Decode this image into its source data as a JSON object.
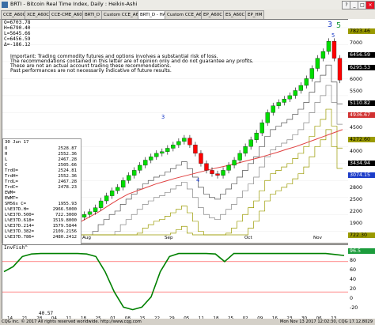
{
  "window": {
    "title": "BRTI - Bitcoin Real Time Index, Daily : Heikin-Ashi",
    "buttons": [
      "?",
      "_",
      "□",
      "×"
    ]
  },
  "tabs": [
    {
      "label": "CCE_A60C",
      "active": false
    },
    {
      "label": "XCE_A60C",
      "active": false
    },
    {
      "label": "CCE-CME_A60C",
      "active": false
    },
    {
      "label": "BRTI_D",
      "active": false
    },
    {
      "label": "Custom CCE_A60C",
      "active": false
    },
    {
      "label": "BRTI_D - HA",
      "active": true
    },
    {
      "label": "Custom CCE_A60C",
      "active": false
    },
    {
      "label": "EP_A60C",
      "active": false
    },
    {
      "label": "ES_A60C",
      "active": false
    },
    {
      "label": "EP_HM",
      "active": false
    }
  ],
  "ohlc": {
    "open": "O=6703.78",
    "high": "H=6790.40",
    "low": "L=5645.66",
    "close": "C=6456.59",
    "change": "Δ=-186.12"
  },
  "disclaimer": [
    "Important: Trading commodity futures and options involves a substantial risk of loss.",
    "The recommendations contained in this letter are of opinion only and do not guarantee any profits.",
    "These are not an actual account trading these recommendations.",
    "Past performances are not necessarily indicative of future results."
  ],
  "data_panel": {
    "date": "30 Jun 17",
    "rows": [
      {
        "label": "O",
        "value": "2528.87"
      },
      {
        "label": "H",
        "value": "2552.36"
      },
      {
        "label": "L",
        "value": "2467.28"
      },
      {
        "label": "C",
        "value": "2505.66"
      },
      {
        "label": "TrdO=",
        "value": "2524.81"
      },
      {
        "label": "TrdH=",
        "value": "2552.36"
      },
      {
        "label": "TrdL=",
        "value": "2467.28"
      },
      {
        "label": "TrdC=",
        "value": "2478.23"
      },
      {
        "label": "EWM=",
        "value": ""
      },
      {
        "label": "EWMT=",
        "value": ""
      },
      {
        "label": "SM56x C=",
        "value": "1955.93"
      },
      {
        "label": "L%E37D.H=",
        "value": "2966.5000"
      },
      {
        "label": "L%E37D.500=",
        "value": "722.3000"
      },
      {
        "label": "L%E37D.618=",
        "value": "1519.8000"
      },
      {
        "label": "L%E37D.214=",
        "value": "1579.5844"
      },
      {
        "label": "L%E37D.382=",
        "value": "2109.2156"
      },
      {
        "label": "L%E37D.786=",
        "value": "2480.2412"
      }
    ]
  },
  "price_axis": [
    {
      "label": "7823.46",
      "style": "olive"
    },
    {
      "label": "7000",
      "style": "plain"
    },
    {
      "label": "6456.59",
      "style": "black"
    },
    {
      "label": "6295.53",
      "style": "black"
    },
    {
      "label": "6000",
      "style": "plain"
    },
    {
      "label": "5500",
      "style": "plain"
    },
    {
      "label": "5110.82",
      "style": "black"
    },
    {
      "label": "4936.67",
      "style": "red"
    },
    {
      "label": "4500",
      "style": "plain"
    },
    {
      "label": "4272.60",
      "style": "olive"
    },
    {
      "label": "4000",
      "style": "plain"
    },
    {
      "label": "3434.94",
      "style": "black"
    },
    {
      "label": "3074.15",
      "style": "blue"
    },
    {
      "label": "2800",
      "style": "plain"
    },
    {
      "label": "2500",
      "style": "plain"
    },
    {
      "label": "2200",
      "style": "plain"
    },
    {
      "label": "1900",
      "style": "plain"
    },
    {
      "label": "722.30",
      "style": "olive"
    }
  ],
  "indicator": {
    "name": "InvFish^",
    "value": "40.57",
    "axis": [
      {
        "label": "96.5",
        "style": "green"
      },
      {
        "label": "80",
        "style": "plain"
      },
      {
        "label": "60",
        "style": "plain"
      },
      {
        "label": "40",
        "style": "plain"
      },
      {
        "label": "20",
        "style": "plain"
      },
      {
        "label": "0",
        "style": "plain"
      },
      {
        "label": "-20",
        "style": "plain"
      }
    ]
  },
  "wave_labels": [
    "3",
    "3",
    "4",
    "5",
    "5"
  ],
  "time_axis": [
    "Aug",
    "Sep",
    "Oct",
    "Nov"
  ],
  "time_ticks": [
    "14",
    "21",
    "28",
    "04",
    "11",
    "18",
    "25",
    "01",
    "08",
    "15",
    "22",
    "29",
    "05",
    "11",
    "18",
    "25",
    "02",
    "09",
    "16",
    "23",
    "30",
    "06",
    "13"
  ],
  "status": {
    "left": "CQG Inc. © 2017 All rights reserved worldwide. http://www.cqg.com",
    "right": "Mon Nov 13 2017 12:02:30, CQG 17.12.8029"
  },
  "colors": {
    "up_bar": "#00dd00",
    "down_bar": "#ff0000",
    "ma_red": "#e04040",
    "band_olive": "#9a9a00",
    "indicator_line": "#008000",
    "indicator_ref": "#ff4040"
  },
  "chart_data": {
    "type": "candlestick",
    "title": "BRTI - Bitcoin Real Time Index, Daily : Heikin-Ashi",
    "ylim": [
      1900,
      8000
    ],
    "x_labels": [
      "Aug",
      "Sep",
      "Oct",
      "Nov"
    ],
    "close_series": [
      2500,
      2580,
      2700,
      2900,
      3050,
      3200,
      3300,
      3500,
      3650,
      3800,
      3950,
      4100,
      4200,
      4300,
      4350,
      4450,
      4550,
      4650,
      4750,
      4550,
      4300,
      4000,
      3800,
      3700,
      3650,
      3800,
      3950,
      4100,
      4300,
      4500,
      4700,
      4900,
      5200,
      5500,
      5700,
      5800,
      5900,
      6000,
      6150,
      6300,
      6500,
      6800,
      7100,
      7300,
      7600,
      7100,
      6456
    ],
    "ma_series": [
      2300,
      2450,
      2600,
      2780,
      2950,
      3100,
      3200,
      3300,
      3400,
      3480,
      3560,
      3630,
      3700,
      3770,
      3840,
      3900,
      3960,
      4030,
      4100,
      4170,
      4250,
      4330,
      4420,
      4500,
      4600,
      4700,
      4800,
      4900,
      5000
    ],
    "indicator_series": [
      60,
      70,
      90,
      95,
      96,
      96,
      96,
      96,
      96,
      95,
      90,
      60,
      20,
      -10,
      -15,
      -10,
      10,
      60,
      90,
      96,
      96,
      96,
      96,
      95,
      80,
      96,
      96,
      96,
      96,
      96,
      96,
      96,
      96,
      96,
      96,
      96,
      94,
      92
    ]
  }
}
